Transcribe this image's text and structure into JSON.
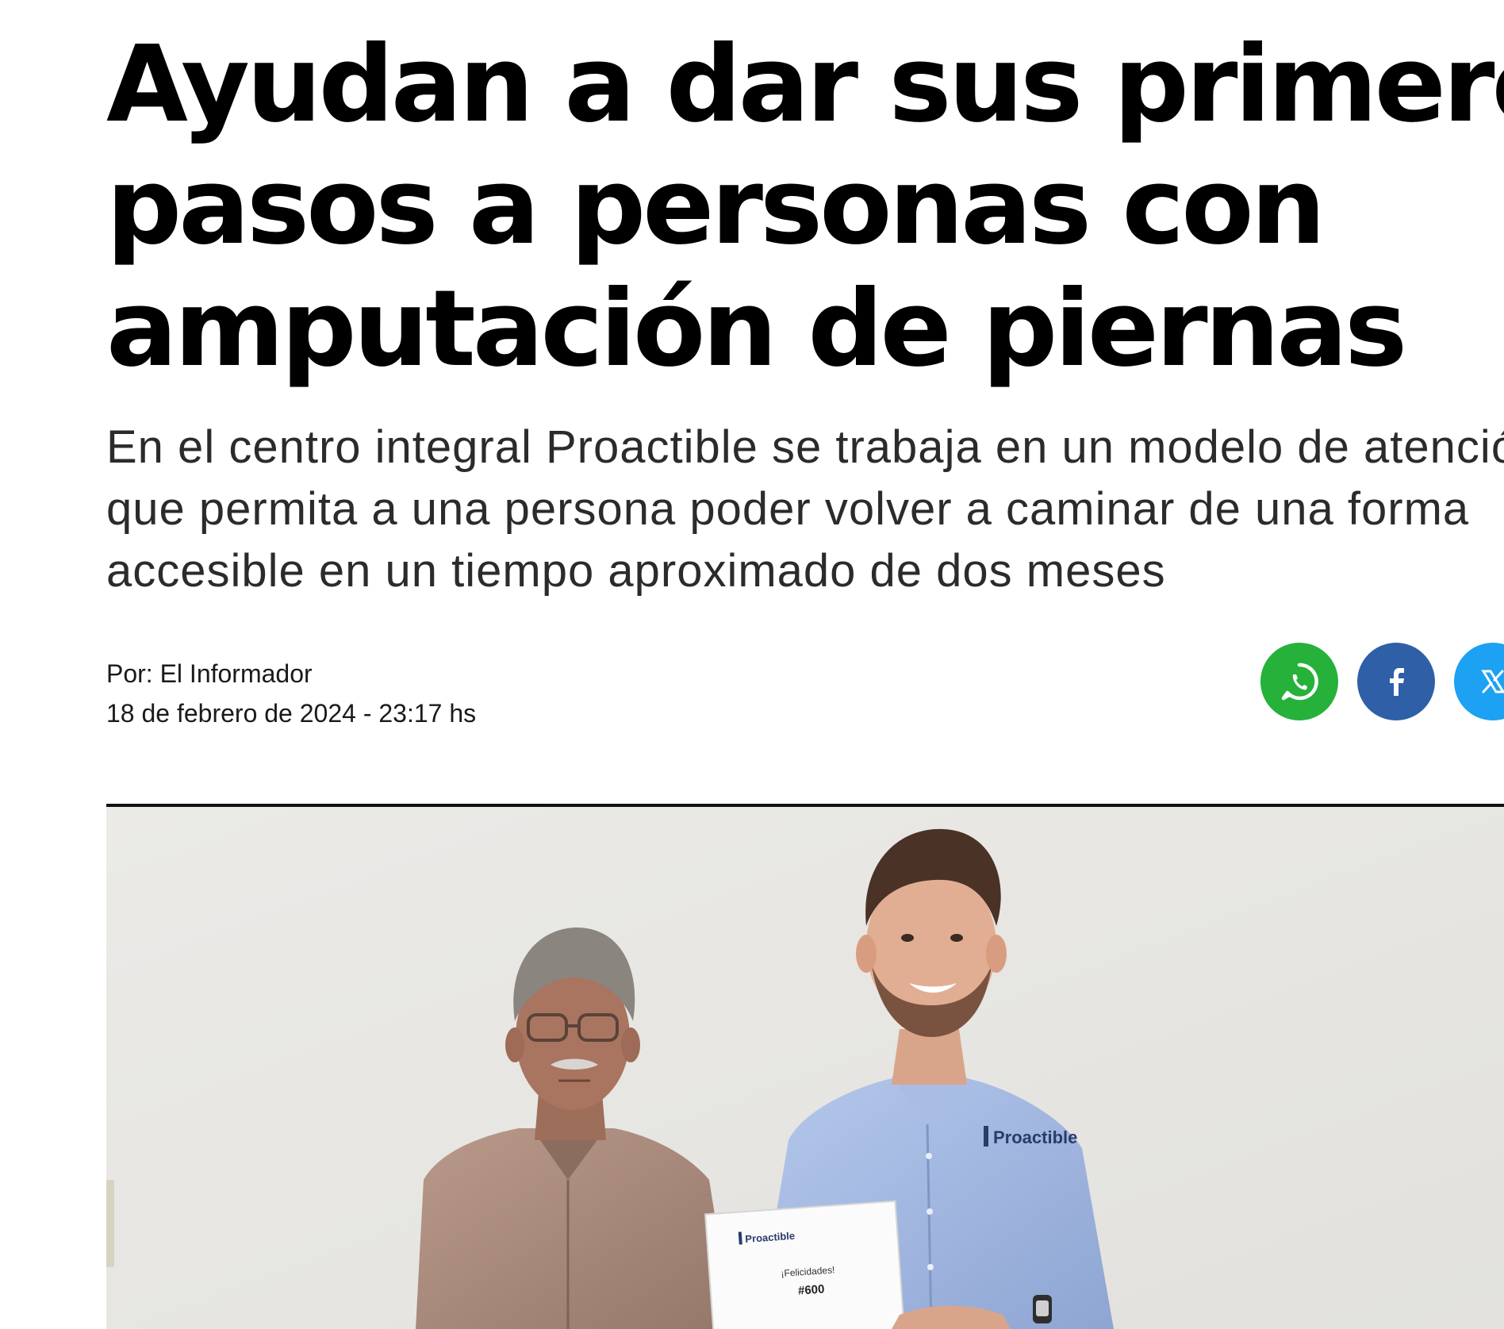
{
  "article": {
    "headline_lines": [
      "Ayudan a dar sus primeros",
      "pasos a personas con",
      "amputación de piernas"
    ],
    "subtitle_lines": [
      "En el centro integral Proactible se trabaja en un modelo de atención",
      "que permita a una persona poder volver a caminar de una forma",
      "accesible en un tiempo aproximado de dos meses"
    ],
    "byline": {
      "author": "Por: El Informador",
      "date": "18 de febrero de 2024 - 23:17 hs"
    },
    "share": [
      {
        "network": "whatsapp",
        "icon": "whatsapp-icon",
        "color": "#25b13a"
      },
      {
        "network": "facebook",
        "icon": "facebook-icon",
        "color": "#2f5fa7"
      },
      {
        "network": "x",
        "icon": "x-icon",
        "color": "#1da1f2"
      }
    ],
    "photo": {
      "shirt_logo": "Proactible",
      "certificate_logo": "Proactible",
      "certificate_heading": "¡Felicidades!",
      "certificate_number": "#600"
    }
  },
  "colors": {
    "headline": "#000000",
    "subtitle": "#2b2b2b",
    "divider": "#111111"
  }
}
